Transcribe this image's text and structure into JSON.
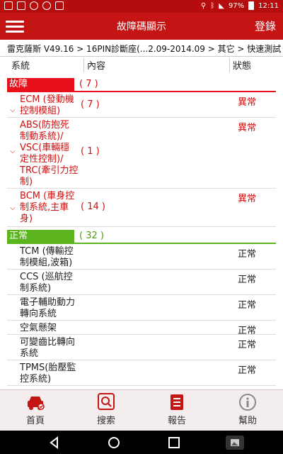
{
  "statusbar": {
    "battery": "97%",
    "time": "12:11"
  },
  "appbar": {
    "title": "故障碼顯示",
    "login_label": "登錄"
  },
  "breadcrumb": "雷克薩斯 V49.16 > 16PIN診斷座(...2.09-2014.09 > 其它 > 快速測試",
  "columns": {
    "system": "系統",
    "content": "內容",
    "status": "狀態"
  },
  "colors": {
    "appbar": "#c41414",
    "fault_group": "#e8101a",
    "normal_group": "#5cb51e",
    "fault_text": "#d00f0f"
  },
  "fault_group": {
    "label": "故障",
    "count": "( 7 )",
    "rows": [
      {
        "name": "ECM (發動機\n控制模組)",
        "count": "( 7 )",
        "status": "異常"
      },
      {
        "name": "ABS(防抱死\n制動系統)/\nVSC(車輛穩\n定性控制)/\nTRC(牽引力控\n制)",
        "count": "( 1 )",
        "status": "異常"
      },
      {
        "name": "BCM (車身控\n制系統,主車\n身)",
        "count": "( 14 )",
        "status": "異常"
      }
    ]
  },
  "normal_group": {
    "label": "正常",
    "count": "( 32 )",
    "rows": [
      {
        "name": "TCM (傳輸控\n制模組,波箱)",
        "status": "正常"
      },
      {
        "name": "CCS (巡航控\n制系統)",
        "status": "正常"
      },
      {
        "name": "電子輔助動力\n轉向系統",
        "status": "正常"
      },
      {
        "name": "空氣懸架",
        "status": "正常"
      },
      {
        "name": "可變齒比轉向\n系統",
        "status": "正常"
      },
      {
        "name": "TPMS(胎壓監\n控系統)",
        "status": "正常"
      }
    ]
  },
  "bottomnav": {
    "home": "首頁",
    "search": "搜索",
    "report": "報告",
    "help": "幫助"
  }
}
